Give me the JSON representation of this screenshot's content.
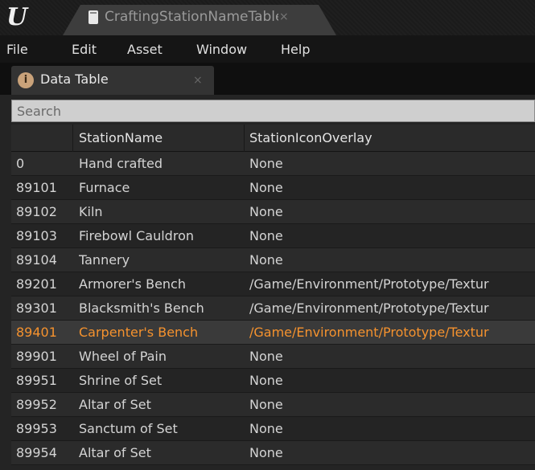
{
  "window": {
    "logo": "U",
    "document_tab_label": "CraftingStationNameTable",
    "document_tab_close": "×"
  },
  "menu": [
    "File",
    "Edit",
    "Asset",
    "Window",
    "Help"
  ],
  "panel": {
    "tab_label": "Data Table",
    "tab_close": "×",
    "tab_icon": "info-icon",
    "tab_icon_glyph": "i"
  },
  "search": {
    "placeholder": "Search",
    "value": ""
  },
  "table": {
    "columns": [
      "",
      "StationName",
      "StationIconOverlay"
    ],
    "selected_row_index": 7,
    "rows": [
      [
        "0",
        "Hand crafted",
        "None"
      ],
      [
        "89101",
        "Furnace",
        "None"
      ],
      [
        "89102",
        "Kiln",
        "None"
      ],
      [
        "89103",
        "Firebowl Cauldron",
        "None"
      ],
      [
        "89104",
        "Tannery",
        "None"
      ],
      [
        "89201",
        "Armorer's Bench",
        "/Game/Environment/Prototype/Textur"
      ],
      [
        "89301",
        "Blacksmith's Bench",
        "/Game/Environment/Prototype/Textur"
      ],
      [
        "89401",
        "Carpenter's Bench",
        "/Game/Environment/Prototype/Textur"
      ],
      [
        "89901",
        "Wheel of Pain",
        "None"
      ],
      [
        "89951",
        "Shrine of Set",
        "None"
      ],
      [
        "89952",
        "Altar of Set",
        "None"
      ],
      [
        "89953",
        "Sanctum of Set",
        "None"
      ],
      [
        "89954",
        "Altar of Set",
        "None"
      ]
    ]
  },
  "colors": {
    "selected_text": "#f5922e",
    "background": "#242424"
  }
}
